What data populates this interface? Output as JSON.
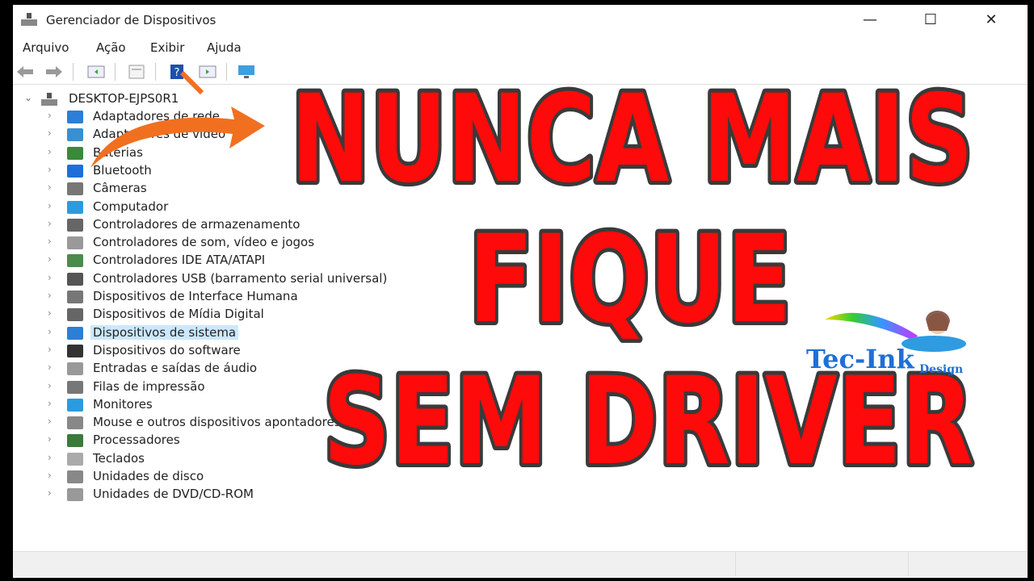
{
  "window": {
    "title": "Gerenciador de Dispositivos",
    "minimize": "—",
    "maximize": "☐",
    "close": "✕"
  },
  "menu": [
    "Arquivo",
    "Ação",
    "Exibir",
    "Ajuda"
  ],
  "toolbar": [
    "back-icon",
    "forward-icon",
    "show-hide-console-tree-icon",
    "properties-icon",
    "help-icon",
    "action-pane-icon",
    "scan-hardware-icon"
  ],
  "tree": {
    "root": "DESKTOP-EJPS0R1",
    "items": [
      {
        "label": "Adaptadores de rede",
        "color": "#2b7fd6"
      },
      {
        "label": "Adaptadores de vídeo",
        "color": "#3a8fd0"
      },
      {
        "label": "Baterias",
        "color": "#3a8a3a"
      },
      {
        "label": "Bluetooth",
        "color": "#1e6fd9"
      },
      {
        "label": "Câmeras",
        "color": "#777777"
      },
      {
        "label": "Computador",
        "color": "#2b9be0"
      },
      {
        "label": "Controladores de armazenamento",
        "color": "#666666"
      },
      {
        "label": "Controladores de som, vídeo e jogos",
        "color": "#999999"
      },
      {
        "label": "Controladores IDE ATA/ATAPI",
        "color": "#4b8b4b"
      },
      {
        "label": "Controladores USB (barramento serial universal)",
        "color": "#555555"
      },
      {
        "label": "Dispositivos de Interface Humana",
        "color": "#777777"
      },
      {
        "label": "Dispositivos de Mídia Digital",
        "color": "#666666"
      },
      {
        "label": "Dispositivos de sistema",
        "color": "#2b7fd6",
        "selected": true
      },
      {
        "label": "Dispositivos do software",
        "color": "#333333"
      },
      {
        "label": "Entradas e saídas de áudio",
        "color": "#999999"
      },
      {
        "label": "Filas de impressão",
        "color": "#777777"
      },
      {
        "label": "Monitores",
        "color": "#2b9be0"
      },
      {
        "label": "Mouse e outros dispositivos apontadores",
        "color": "#888888"
      },
      {
        "label": "Processadores",
        "color": "#3a7a3a"
      },
      {
        "label": "Teclados",
        "color": "#aaaaaa"
      },
      {
        "label": "Unidades de disco",
        "color": "#888888"
      },
      {
        "label": "Unidades de DVD/CD-ROM",
        "color": "#999999"
      }
    ]
  },
  "overlay": {
    "line1": "NUNCA MAIS",
    "line2": "FIQUE",
    "line3": "SEM DRIVER",
    "text_color": "#ff0a0a",
    "outline_color": "#3a3a3a",
    "arrow_color": "#f07020"
  },
  "logo": {
    "main": "Tec-Ink",
    "sub": "Design"
  }
}
